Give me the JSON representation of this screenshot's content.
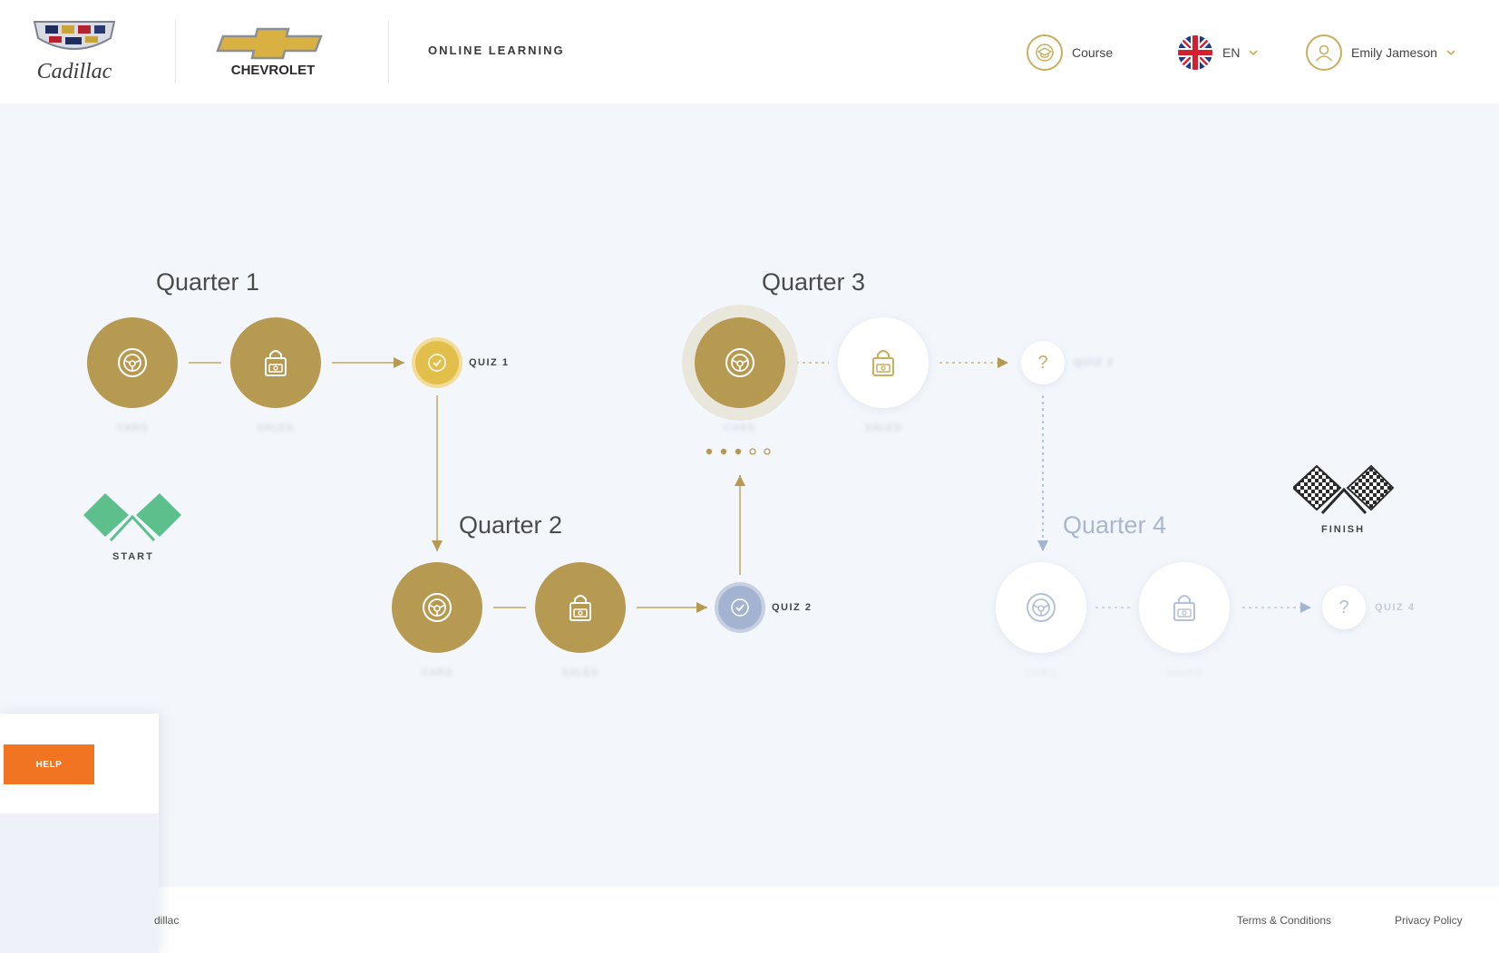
{
  "header": {
    "cadillac_logo_text": "Cadillac",
    "chevrolet_logo_text": "CHEVROLET",
    "section_title": "ONLINE LEARNING",
    "course_label": "Course",
    "language": "EN",
    "user_name": "Emily Jameson"
  },
  "map": {
    "quarters": [
      {
        "title": "Quarter 1",
        "status": "completed"
      },
      {
        "title": "Quarter 2",
        "status": "completed"
      },
      {
        "title": "Quarter 3",
        "status": "in-progress"
      },
      {
        "title": "Quarter 4",
        "status": "locked"
      }
    ],
    "quizzes": [
      {
        "label": "QUIZ 1",
        "status": "passed"
      },
      {
        "label": "QUIZ 2",
        "status": "passed"
      },
      {
        "label": "QUIZ 3",
        "status": "open"
      },
      {
        "label": "QUIZ 4",
        "status": "locked"
      }
    ],
    "module_labels": {
      "cars": "CARS",
      "sales": "SALES"
    },
    "start_label": "START",
    "finish_label": "FINISH",
    "quarter3_progress_steps": {
      "completed": 3,
      "total": 5
    },
    "colors": {
      "gold": "#b69a52",
      "quiz_gold": "#e2bf4a",
      "quiz_blue": "#a3b3d1",
      "start_green": "#5cbf8c",
      "help_orange": "#f07421"
    }
  },
  "help": {
    "button_label": "HELP"
  },
  "footer": {
    "copyright": "dillac",
    "terms": "Terms & Conditions",
    "privacy": "Privacy Policy"
  }
}
